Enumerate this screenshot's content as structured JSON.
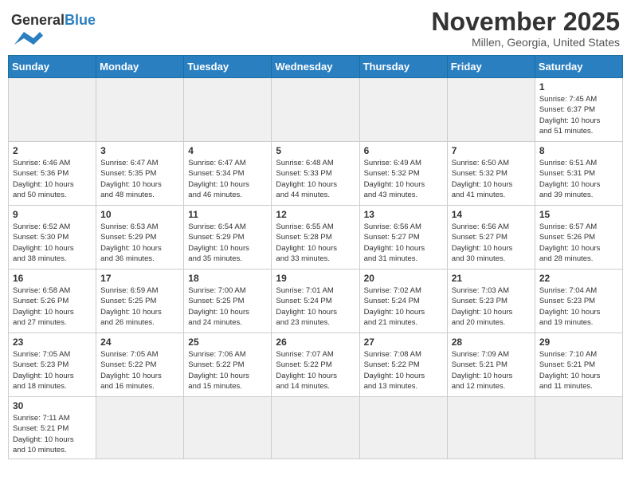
{
  "header": {
    "logo_general": "General",
    "logo_blue": "Blue",
    "month_title": "November 2025",
    "location": "Millen, Georgia, United States"
  },
  "weekdays": [
    "Sunday",
    "Monday",
    "Tuesday",
    "Wednesday",
    "Thursday",
    "Friday",
    "Saturday"
  ],
  "weeks": [
    [
      {
        "day": "",
        "info": ""
      },
      {
        "day": "",
        "info": ""
      },
      {
        "day": "",
        "info": ""
      },
      {
        "day": "",
        "info": ""
      },
      {
        "day": "",
        "info": ""
      },
      {
        "day": "",
        "info": ""
      },
      {
        "day": "1",
        "info": "Sunrise: 7:45 AM\nSunset: 6:37 PM\nDaylight: 10 hours\nand 51 minutes."
      }
    ],
    [
      {
        "day": "2",
        "info": "Sunrise: 6:46 AM\nSunset: 5:36 PM\nDaylight: 10 hours\nand 50 minutes."
      },
      {
        "day": "3",
        "info": "Sunrise: 6:47 AM\nSunset: 5:35 PM\nDaylight: 10 hours\nand 48 minutes."
      },
      {
        "day": "4",
        "info": "Sunrise: 6:47 AM\nSunset: 5:34 PM\nDaylight: 10 hours\nand 46 minutes."
      },
      {
        "day": "5",
        "info": "Sunrise: 6:48 AM\nSunset: 5:33 PM\nDaylight: 10 hours\nand 44 minutes."
      },
      {
        "day": "6",
        "info": "Sunrise: 6:49 AM\nSunset: 5:32 PM\nDaylight: 10 hours\nand 43 minutes."
      },
      {
        "day": "7",
        "info": "Sunrise: 6:50 AM\nSunset: 5:32 PM\nDaylight: 10 hours\nand 41 minutes."
      },
      {
        "day": "8",
        "info": "Sunrise: 6:51 AM\nSunset: 5:31 PM\nDaylight: 10 hours\nand 39 minutes."
      }
    ],
    [
      {
        "day": "9",
        "info": "Sunrise: 6:52 AM\nSunset: 5:30 PM\nDaylight: 10 hours\nand 38 minutes."
      },
      {
        "day": "10",
        "info": "Sunrise: 6:53 AM\nSunset: 5:29 PM\nDaylight: 10 hours\nand 36 minutes."
      },
      {
        "day": "11",
        "info": "Sunrise: 6:54 AM\nSunset: 5:29 PM\nDaylight: 10 hours\nand 35 minutes."
      },
      {
        "day": "12",
        "info": "Sunrise: 6:55 AM\nSunset: 5:28 PM\nDaylight: 10 hours\nand 33 minutes."
      },
      {
        "day": "13",
        "info": "Sunrise: 6:56 AM\nSunset: 5:27 PM\nDaylight: 10 hours\nand 31 minutes."
      },
      {
        "day": "14",
        "info": "Sunrise: 6:56 AM\nSunset: 5:27 PM\nDaylight: 10 hours\nand 30 minutes."
      },
      {
        "day": "15",
        "info": "Sunrise: 6:57 AM\nSunset: 5:26 PM\nDaylight: 10 hours\nand 28 minutes."
      }
    ],
    [
      {
        "day": "16",
        "info": "Sunrise: 6:58 AM\nSunset: 5:26 PM\nDaylight: 10 hours\nand 27 minutes."
      },
      {
        "day": "17",
        "info": "Sunrise: 6:59 AM\nSunset: 5:25 PM\nDaylight: 10 hours\nand 26 minutes."
      },
      {
        "day": "18",
        "info": "Sunrise: 7:00 AM\nSunset: 5:25 PM\nDaylight: 10 hours\nand 24 minutes."
      },
      {
        "day": "19",
        "info": "Sunrise: 7:01 AM\nSunset: 5:24 PM\nDaylight: 10 hours\nand 23 minutes."
      },
      {
        "day": "20",
        "info": "Sunrise: 7:02 AM\nSunset: 5:24 PM\nDaylight: 10 hours\nand 21 minutes."
      },
      {
        "day": "21",
        "info": "Sunrise: 7:03 AM\nSunset: 5:23 PM\nDaylight: 10 hours\nand 20 minutes."
      },
      {
        "day": "22",
        "info": "Sunrise: 7:04 AM\nSunset: 5:23 PM\nDaylight: 10 hours\nand 19 minutes."
      }
    ],
    [
      {
        "day": "23",
        "info": "Sunrise: 7:05 AM\nSunset: 5:23 PM\nDaylight: 10 hours\nand 18 minutes."
      },
      {
        "day": "24",
        "info": "Sunrise: 7:05 AM\nSunset: 5:22 PM\nDaylight: 10 hours\nand 16 minutes."
      },
      {
        "day": "25",
        "info": "Sunrise: 7:06 AM\nSunset: 5:22 PM\nDaylight: 10 hours\nand 15 minutes."
      },
      {
        "day": "26",
        "info": "Sunrise: 7:07 AM\nSunset: 5:22 PM\nDaylight: 10 hours\nand 14 minutes."
      },
      {
        "day": "27",
        "info": "Sunrise: 7:08 AM\nSunset: 5:22 PM\nDaylight: 10 hours\nand 13 minutes."
      },
      {
        "day": "28",
        "info": "Sunrise: 7:09 AM\nSunset: 5:21 PM\nDaylight: 10 hours\nand 12 minutes."
      },
      {
        "day": "29",
        "info": "Sunrise: 7:10 AM\nSunset: 5:21 PM\nDaylight: 10 hours\nand 11 minutes."
      }
    ],
    [
      {
        "day": "30",
        "info": "Sunrise: 7:11 AM\nSunset: 5:21 PM\nDaylight: 10 hours\nand 10 minutes."
      },
      {
        "day": "",
        "info": ""
      },
      {
        "day": "",
        "info": ""
      },
      {
        "day": "",
        "info": ""
      },
      {
        "day": "",
        "info": ""
      },
      {
        "day": "",
        "info": ""
      },
      {
        "day": "",
        "info": ""
      }
    ]
  ]
}
